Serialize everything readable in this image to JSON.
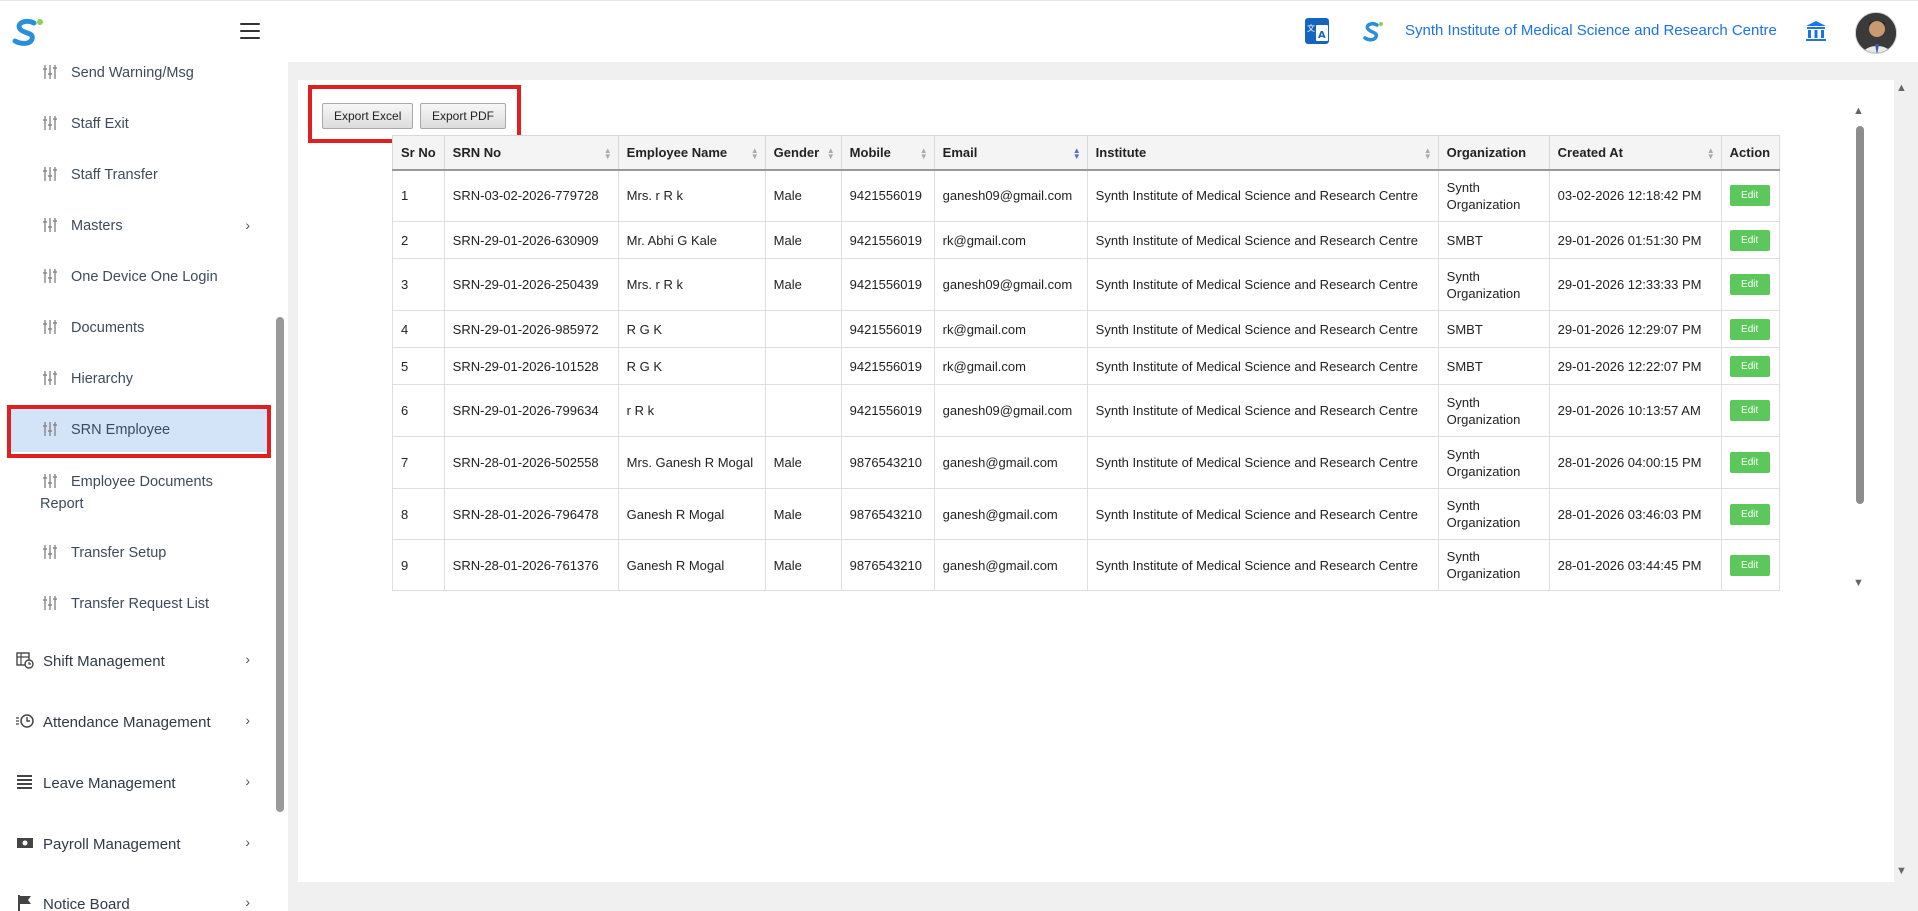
{
  "header": {
    "institute_name": "Synth Institute of Medical Science and Research Centre",
    "icons": [
      "logo-icon",
      "menu-icon",
      "translate-icon",
      "institute-logo-icon",
      "bank-icon",
      "avatar"
    ]
  },
  "sidebar": {
    "items": [
      {
        "label": "Send Warning/Msg"
      },
      {
        "label": "Staff Exit"
      },
      {
        "label": "Staff Transfer"
      },
      {
        "label": "Masters"
      },
      {
        "label": "One Device One Login"
      },
      {
        "label": "Documents"
      },
      {
        "label": "Hierarchy"
      },
      {
        "label": "SRN Employee"
      },
      {
        "label": "Employee Documents"
      },
      {
        "label": "Report"
      },
      {
        "label": "Transfer Setup"
      },
      {
        "label": "Transfer Request List"
      }
    ],
    "sections": [
      {
        "label": "Shift Management"
      },
      {
        "label": "Attendance Management"
      },
      {
        "label": "Leave Management"
      },
      {
        "label": "Payroll Management"
      },
      {
        "label": "Notice Board"
      }
    ]
  },
  "toolbar": {
    "export_excel": "Export Excel",
    "export_pdf": "Export PDF"
  },
  "table": {
    "headers": [
      "Sr No",
      "SRN No",
      "Employee Name",
      "Gender",
      "Mobile",
      "Email",
      "Institute",
      "Organization",
      "Created At",
      "Action"
    ],
    "edit_label": "Edit",
    "rows": [
      {
        "sr": "1",
        "srn": "SRN-03-02-2026-779728",
        "name": "Mrs. r R k",
        "gender": "Male",
        "mobile": "9421556019",
        "email": "ganesh09@gmail.com",
        "institute": "Synth Institute of Medical Science and Research Centre",
        "org": "Synth Organization",
        "created": "03-02-2026 12:18:42 PM"
      },
      {
        "sr": "2",
        "srn": "SRN-29-01-2026-630909",
        "name": "Mr. Abhi G Kale",
        "gender": "Male",
        "mobile": "9421556019",
        "email": "rk@gmail.com",
        "institute": "Synth Institute of Medical Science and Research Centre",
        "org": "SMBT",
        "created": "29-01-2026 01:51:30 PM"
      },
      {
        "sr": "3",
        "srn": "SRN-29-01-2026-250439",
        "name": "Mrs. r R k",
        "gender": "Male",
        "mobile": "9421556019",
        "email": "ganesh09@gmail.com",
        "institute": "Synth Institute of Medical Science and Research Centre",
        "org": "Synth Organization",
        "created": "29-01-2026 12:33:33 PM"
      },
      {
        "sr": "4",
        "srn": "SRN-29-01-2026-985972",
        "name": "R G K",
        "gender": "",
        "mobile": "9421556019",
        "email": "rk@gmail.com",
        "institute": "Synth Institute of Medical Science and Research Centre",
        "org": "SMBT",
        "created": "29-01-2026 12:29:07 PM"
      },
      {
        "sr": "5",
        "srn": "SRN-29-01-2026-101528",
        "name": "R G K",
        "gender": "",
        "mobile": "9421556019",
        "email": "rk@gmail.com",
        "institute": "Synth Institute of Medical Science and Research Centre",
        "org": "SMBT",
        "created": "29-01-2026 12:22:07 PM"
      },
      {
        "sr": "6",
        "srn": "SRN-29-01-2026-799634",
        "name": "r R k",
        "gender": "",
        "mobile": "9421556019",
        "email": "ganesh09@gmail.com",
        "institute": "Synth Institute of Medical Science and Research Centre",
        "org": "Synth Organization",
        "created": "29-01-2026 10:13:57 AM"
      },
      {
        "sr": "7",
        "srn": "SRN-28-01-2026-502558",
        "name": "Mrs. Ganesh R Mogal",
        "gender": "Male",
        "mobile": "9876543210",
        "email": "ganesh@gmail.com",
        "institute": "Synth Institute of Medical Science and Research Centre",
        "org": "Synth Organization",
        "created": "28-01-2026 04:00:15 PM"
      },
      {
        "sr": "8",
        "srn": "SRN-28-01-2026-796478",
        "name": "Ganesh R Mogal",
        "gender": "Male",
        "mobile": "9876543210",
        "email": "ganesh@gmail.com",
        "institute": "Synth Institute of Medical Science and Research Centre",
        "org": "Synth Organization",
        "created": "28-01-2026 03:46:03 PM"
      },
      {
        "sr": "9",
        "srn": "SRN-28-01-2026-761376",
        "name": "Ganesh R Mogal",
        "gender": "Male",
        "mobile": "9876543210",
        "email": "ganesh@gmail.com",
        "institute": "Synth Institute of Medical Science and Research Centre",
        "org": "Synth Organization",
        "created": "28-01-2026 03:44:45 PM"
      }
    ]
  },
  "colors": {
    "accent": "#1a73e8",
    "active_bg": "#d3e3f8",
    "highlight": "#e02020",
    "edit": "#5cc85c"
  }
}
